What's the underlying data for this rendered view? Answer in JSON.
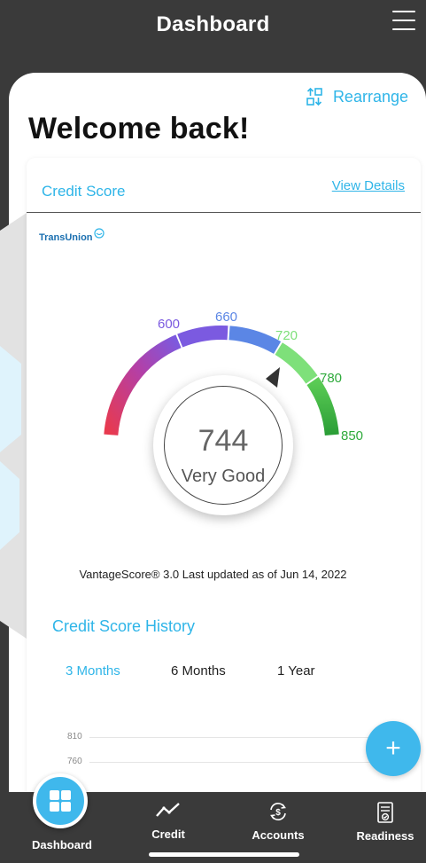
{
  "header": {
    "title": "Dashboard"
  },
  "rearrange": {
    "label": "Rearrange"
  },
  "welcome": "Welcome back!",
  "credit_card": {
    "title": "Credit Score",
    "view_details": "View Details",
    "bureau": "TransUnion",
    "score": "744",
    "rating": "Very Good",
    "gauge_ticks": [
      "600",
      "660",
      "720",
      "780",
      "850"
    ],
    "footnote": "VantageScore® 3.0 Last updated as of Jun 14, 2022"
  },
  "history": {
    "title": "Credit Score History",
    "tabs": [
      "3 Months",
      "6 Months",
      "1 Year"
    ],
    "active_tab": "3 Months",
    "y_labels": [
      "810",
      "760"
    ]
  },
  "fab": {
    "symbol": "+"
  },
  "bottom_nav": {
    "items": [
      "Dashboard",
      "Credit",
      "Accounts",
      "Readiness"
    ]
  },
  "colors": {
    "accent": "#2fb5e8",
    "bar": "#3a3a3a",
    "gauge_red": "#e83a4f",
    "gauge_purple": "#7b5ae0",
    "gauge_blue": "#5b86e5",
    "gauge_lightgreen": "#7ee07a",
    "gauge_green": "#2faa3c"
  }
}
